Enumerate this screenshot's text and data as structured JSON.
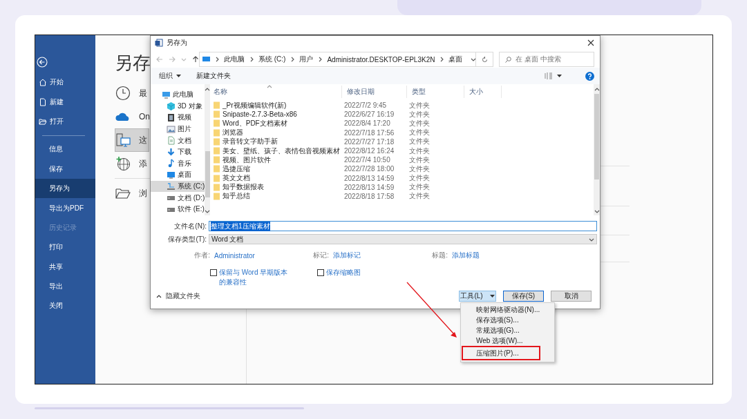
{
  "sidebar": {
    "top_items": [
      {
        "label": "开始",
        "kind": "home"
      },
      {
        "label": "新建",
        "kind": "new"
      },
      {
        "label": "打开",
        "kind": "open"
      }
    ],
    "items": [
      {
        "label": "信息",
        "selected": false,
        "disabled": false
      },
      {
        "label": "保存",
        "selected": false,
        "disabled": false
      },
      {
        "label": "另存为",
        "selected": true,
        "disabled": false
      },
      {
        "label": "导出为PDF",
        "selected": false,
        "disabled": false
      },
      {
        "label": "历史记录",
        "selected": false,
        "disabled": true
      },
      {
        "label": "打印",
        "selected": false,
        "disabled": false
      },
      {
        "label": "共享",
        "selected": false,
        "disabled": false
      },
      {
        "label": "导出",
        "selected": false,
        "disabled": false
      },
      {
        "label": "关闭",
        "selected": false,
        "disabled": false
      }
    ]
  },
  "backstage": {
    "title": "另存",
    "locations": [
      {
        "label": "最",
        "kind": "recent",
        "selected": false
      },
      {
        "label": "On",
        "kind": "cloud",
        "selected": false
      },
      {
        "label": "这",
        "kind": "computer",
        "selected": true
      },
      {
        "label": "添",
        "kind": "add-place",
        "selected": false
      },
      {
        "label": "浏",
        "kind": "browse",
        "selected": false
      }
    ]
  },
  "dialog": {
    "title": "另存为",
    "breadcrumbs": [
      "此电脑",
      "系统 (C:)",
      "用户",
      "Administrator.DESKTOP-EPL3K2N",
      "桌面"
    ],
    "search_placeholder": "在 桌面 中搜索",
    "toolbar": {
      "organize": "组织",
      "new_folder": "新建文件夹"
    },
    "tree": [
      {
        "label": "此电脑",
        "kind": "pc",
        "selected": false,
        "children": [
          {
            "label": "3D 对象",
            "kind": "cube",
            "selected": false
          },
          {
            "label": "视频",
            "kind": "video",
            "selected": false
          },
          {
            "label": "图片",
            "kind": "picture",
            "selected": false
          },
          {
            "label": "文档",
            "kind": "doc",
            "selected": false
          },
          {
            "label": "下载",
            "kind": "download",
            "selected": false
          },
          {
            "label": "音乐",
            "kind": "music",
            "selected": false
          },
          {
            "label": "桌面",
            "kind": "desktop",
            "selected": false
          },
          {
            "label": "系统 (C:)",
            "kind": "system-drive",
            "selected": true
          },
          {
            "label": "文档 (D:)",
            "kind": "drive",
            "selected": false
          },
          {
            "label": "软件 (E:)",
            "kind": "drive",
            "selected": false
          }
        ]
      }
    ],
    "columns": [
      "名称",
      "修改日期",
      "类型",
      "大小"
    ],
    "rows": [
      {
        "name": "_Pr视频编辑软件(新)",
        "date": "2022/7/2 9:45",
        "type": "文件夹"
      },
      {
        "name": "Snipaste-2.7.3-Beta-x86",
        "date": "2022/6/27 16:19",
        "type": "文件夹"
      },
      {
        "name": "Word、PDF文档素材",
        "date": "2022/8/4 17:20",
        "type": "文件夹"
      },
      {
        "name": "浏览器",
        "date": "2022/7/18 17:56",
        "type": "文件夹"
      },
      {
        "name": "录音转文字助手新",
        "date": "2022/7/27 17:18",
        "type": "文件夹"
      },
      {
        "name": "美女、壁纸、孩子、表情包音视频素材",
        "date": "2022/8/12 16:24",
        "type": "文件夹"
      },
      {
        "name": "视频、图片软件",
        "date": "2022/7/4 10:50",
        "type": "文件夹"
      },
      {
        "name": "迅捷压缩",
        "date": "2022/7/28 18:00",
        "type": "文件夹"
      },
      {
        "name": "英文文档",
        "date": "2022/8/13 14:59",
        "type": "文件夹"
      },
      {
        "name": "知乎数据报表",
        "date": "2022/8/13 14:59",
        "type": "文件夹"
      },
      {
        "name": "知乎总结",
        "date": "2022/8/18 17:58",
        "type": "文件夹"
      }
    ],
    "filename": {
      "label": "文件名(N):",
      "value": "整理文档1压缩素材",
      "selected": true
    },
    "save_type": {
      "label": "保存类型(T):",
      "value": "Word 文档"
    },
    "meta": [
      {
        "label": "作者:",
        "value": "Administrator"
      },
      {
        "label": "标记:",
        "value": "添加标记"
      },
      {
        "label": "标题:",
        "value": "添加标题"
      }
    ],
    "checkboxes": [
      {
        "label": "保留与 Word 早期版本的兼容性",
        "checked": false
      },
      {
        "label": "保存缩略图",
        "checked": false
      }
    ],
    "hide_folders": "隐藏文件夹",
    "buttons": [
      {
        "label": "工具(L)",
        "kind": "menu",
        "active": true
      },
      {
        "label": "保存(S)",
        "kind": "default",
        "active": false
      },
      {
        "label": "取消",
        "kind": "normal",
        "active": false
      }
    ]
  },
  "tools_menu": [
    {
      "label": "映射网络驱动器(N)...",
      "highlighted": false
    },
    {
      "label": "保存选项(S)...",
      "highlighted": false
    },
    {
      "label": "常规选项(G)...",
      "highlighted": false
    },
    {
      "label": "Web 选项(W)...",
      "highlighted": false
    },
    {
      "label": "压缩图片(P)...",
      "highlighted": true
    }
  ]
}
